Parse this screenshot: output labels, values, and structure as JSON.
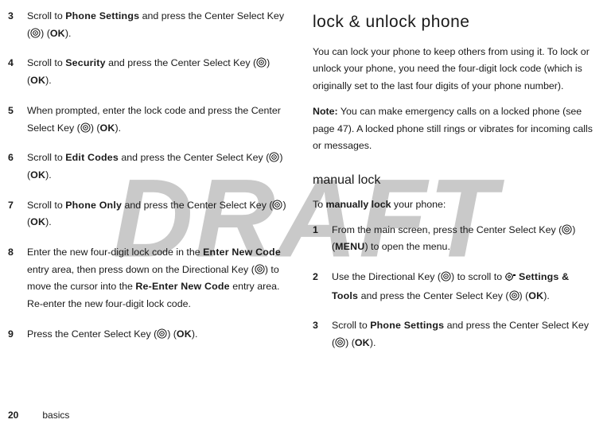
{
  "watermark": "DRAFT",
  "left": {
    "steps": [
      {
        "num": "3",
        "pre": "Scroll to ",
        "term": "Phone Settings",
        "post": " and press the Center Select Key (",
        "key": "OK",
        "tail": ")."
      },
      {
        "num": "4",
        "pre": "Scroll to ",
        "term": "Security",
        "post": " and press the Center Select Key (",
        "key": "OK",
        "tail": ")."
      },
      {
        "num": "5",
        "pre": "When prompted, enter the lock code and press the Center Select Key (",
        "term": "",
        "post": "",
        "key": "OK",
        "tail": ")."
      },
      {
        "num": "6",
        "pre": "Scroll to ",
        "term": "Edit Codes",
        "post": " and press the Center Select Key (",
        "key": "OK",
        "tail": ")."
      },
      {
        "num": "7",
        "pre": "Scroll to ",
        "term": "Phone Only",
        "post": " and press the Center Select Key (",
        "key": "OK",
        "tail": ")."
      }
    ],
    "step8": {
      "num": "8",
      "t1": "Enter the new four-digit lock code in the ",
      "term1": "Enter New Code",
      "t2": " entry area, then press down on the Directional Key (",
      "t3": ") to move the cursor into the ",
      "term2": "Re-Enter New Code",
      "t4": " entry area. Re-enter the new four-digit lock code."
    },
    "step9": {
      "num": "9",
      "t1": "Press the Center Select Key (",
      "key": "OK",
      "t2": ")."
    }
  },
  "right": {
    "h1": "lock & unlock phone",
    "p1": "You can lock your phone to keep others from using it. To lock or unlock your phone, you need the four-digit lock code (which is originally set to the last four digits of your phone number).",
    "noteLabel": "Note:",
    "p2": " You can make emergency calls on a locked phone (see page 47). A locked phone still rings or vibrates for incoming calls or messages.",
    "h2": "manual lock",
    "lead1": "To ",
    "leadBold": "manually lock",
    "lead2": " your phone:",
    "s1": {
      "num": "1",
      "t1": "From the main screen, press the Center Select Key (",
      "key": "MENU",
      "t2": ") to open the menu."
    },
    "s2": {
      "num": "2",
      "t1": "Use the Directional Key (",
      "t2": ") to scroll to ",
      "term": "Settings & Tools",
      "t3": " and press the Center Select Key (",
      "key": "OK",
      "t4": ")."
    },
    "s3": {
      "num": "3",
      "t1": "Scroll to ",
      "term": "Phone Settings",
      "t2": " and press the Center Select Key (",
      "key": "OK",
      "t3": ")."
    }
  },
  "footer": {
    "pagenum": "20",
    "section": "basics"
  }
}
